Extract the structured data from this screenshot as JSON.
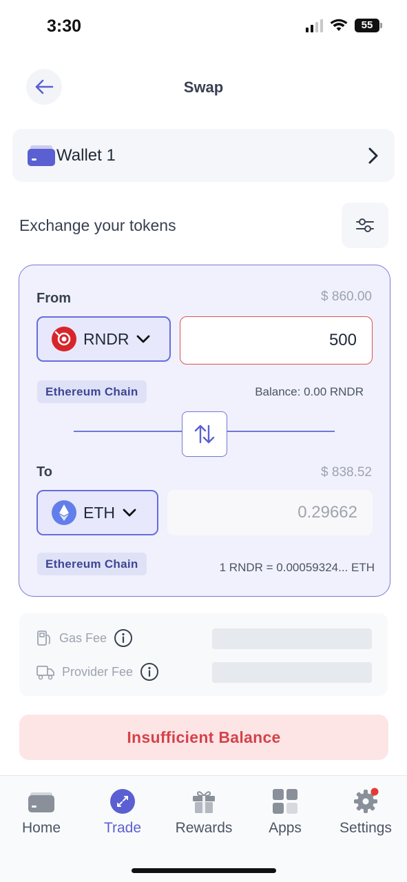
{
  "status_bar": {
    "time": "3:30",
    "battery": "55"
  },
  "header": {
    "title": "Swap"
  },
  "wallet": {
    "name": "Wallet 1"
  },
  "exchange": {
    "title": "Exchange your tokens"
  },
  "from": {
    "label": "From",
    "usd_value": "$ 860.00",
    "token": "RNDR",
    "amount": "500",
    "chain": "Ethereum Chain",
    "balance": "Balance: 0.00 RNDR"
  },
  "to": {
    "label": "To",
    "usd_value": "$ 838.52",
    "token": "ETH",
    "amount": "0.29662",
    "chain": "Ethereum Chain",
    "rate": "1 RNDR = 0.00059324... ETH"
  },
  "fees": {
    "gas_fee_label": "Gas Fee",
    "provider_fee_label": "Provider Fee"
  },
  "cta": {
    "label": "Insufficient Balance"
  },
  "tabbar": {
    "items": [
      {
        "label": "Home",
        "icon": "wallet-icon"
      },
      {
        "label": "Trade",
        "icon": "trade-icon",
        "active": true
      },
      {
        "label": "Rewards",
        "icon": "gift-icon"
      },
      {
        "label": "Apps",
        "icon": "apps-grid-icon"
      },
      {
        "label": "Settings",
        "icon": "gear-icon",
        "badge": true
      }
    ]
  },
  "colors": {
    "accent": "#5a5fd1",
    "panel_bg": "#f0f1fc",
    "error": "#d4434a",
    "rndr_red": "#d7262b",
    "eth_blue": "#627eea"
  }
}
